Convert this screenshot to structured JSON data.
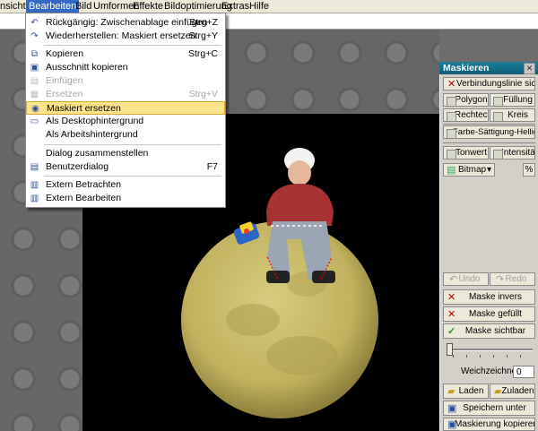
{
  "menubar": {
    "items": [
      "nsicht",
      "Bearbeiten",
      "Bild",
      "Umformen",
      "Effekte",
      "Bildoptimierung",
      "Extras",
      "Hilfe"
    ]
  },
  "edit_menu": {
    "items": [
      {
        "label": "Rückgängig: Zwischenablage einfügen",
        "shortcut": "Strg+Z",
        "icon": "undo-icon",
        "disabled": false
      },
      {
        "label": "Wiederherstellen: Maskiert ersetzen",
        "shortcut": "Strg+Y",
        "icon": "redo-icon",
        "disabled": false
      },
      {
        "label": "Kopieren",
        "shortcut": "Strg+C",
        "icon": "copy-icon",
        "disabled": false
      },
      {
        "label": "Ausschnitt kopieren",
        "shortcut": "",
        "icon": "crop-copy-icon",
        "disabled": false
      },
      {
        "label": "Einfügen",
        "shortcut": "",
        "icon": "paste-icon",
        "disabled": true
      },
      {
        "label": "Ersetzen",
        "shortcut": "Strg+V",
        "icon": "replace-icon",
        "disabled": true
      },
      {
        "label": "Maskiert ersetzen",
        "shortcut": "",
        "icon": "masked-replace-icon",
        "disabled": false,
        "highlighted": true
      },
      {
        "label": "Als Desktophintergrund",
        "shortcut": "",
        "icon": "desktop-icon",
        "disabled": false
      },
      {
        "label": "Als Arbeitshintergrund",
        "shortcut": "",
        "icon": "",
        "disabled": false
      },
      {
        "label": "Dialog zusammenstellen",
        "shortcut": "",
        "icon": "",
        "disabled": false
      },
      {
        "label": "Benutzerdialog",
        "shortcut": "F7",
        "icon": "dialog-icon",
        "disabled": false
      },
      {
        "label": "Extern Betrachten",
        "shortcut": "",
        "icon": "view-icon",
        "disabled": false
      },
      {
        "label": "Extern Bearbeiten",
        "shortcut": "",
        "icon": "edit-icon",
        "disabled": false
      }
    ]
  },
  "panel": {
    "title": "Maskieren",
    "close_icon": "close-icon",
    "connection_line": "Verbindungslinie sichtbar",
    "polygon": "Polygon",
    "fill": "Füllung",
    "rectangle": "Rechteck",
    "circle": "Kreis",
    "color_mode": "Farbe-Sättigung-Helligkeit",
    "tone_value": "Tonwert",
    "intensity": "Intensität",
    "bitmap": "Bitmap",
    "percent": "%",
    "undo": "Undo",
    "redo": "Redo",
    "mask_invert": "Maske invers",
    "mask_filled": "Maske gefüllt",
    "mask_visible": "Maske sichtbar",
    "soft_drawer_label": "Weichzeichner",
    "soft_drawer_value": "0",
    "load": "Laden",
    "add_load": "Zuladen",
    "save_as": "Speichern unter",
    "copy_mask": "Maskierung kopieren"
  },
  "colors": {
    "menu_highlight": "#fde38c",
    "panel_title": "#1b7f9b",
    "moon": "#c9b96a"
  }
}
